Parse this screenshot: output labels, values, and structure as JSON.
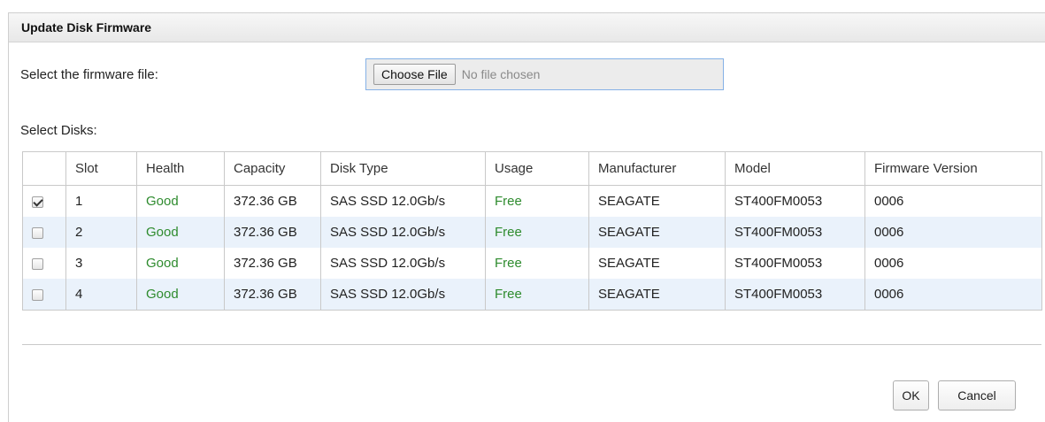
{
  "dialog": {
    "title": "Update Disk Firmware",
    "firmware_label": "Select the firmware file:",
    "choose_file_label": "Choose File",
    "no_file_text": "No file chosen",
    "select_disks_label": "Select Disks:",
    "ok_label": "OK",
    "cancel_label": "Cancel"
  },
  "table": {
    "columns": [
      "",
      "Slot",
      "Health",
      "Capacity",
      "Disk Type",
      "Usage",
      "Manufacturer",
      "Model",
      "Firmware Version"
    ],
    "rows": [
      {
        "checked": true,
        "slot": "1",
        "health": "Good",
        "capacity": "372.36 GB",
        "disk_type": "SAS SSD 12.0Gb/s",
        "usage": "Free",
        "manufacturer": "SEAGATE",
        "model": "ST400FM0053",
        "firmware": "0006"
      },
      {
        "checked": false,
        "slot": "2",
        "health": "Good",
        "capacity": "372.36 GB",
        "disk_type": "SAS SSD 12.0Gb/s",
        "usage": "Free",
        "manufacturer": "SEAGATE",
        "model": "ST400FM0053",
        "firmware": "0006"
      },
      {
        "checked": false,
        "slot": "3",
        "health": "Good",
        "capacity": "372.36 GB",
        "disk_type": "SAS SSD 12.0Gb/s",
        "usage": "Free",
        "manufacturer": "SEAGATE",
        "model": "ST400FM0053",
        "firmware": "0006"
      },
      {
        "checked": false,
        "slot": "4",
        "health": "Good",
        "capacity": "372.36 GB",
        "disk_type": "SAS SSD 12.0Gb/s",
        "usage": "Free",
        "manufacturer": "SEAGATE",
        "model": "ST400FM0053",
        "firmware": "0006"
      }
    ]
  },
  "colors": {
    "status_green": "#2e8b2e",
    "row_stripe": "#eaf2fb",
    "focus_border": "#85b1e6"
  }
}
